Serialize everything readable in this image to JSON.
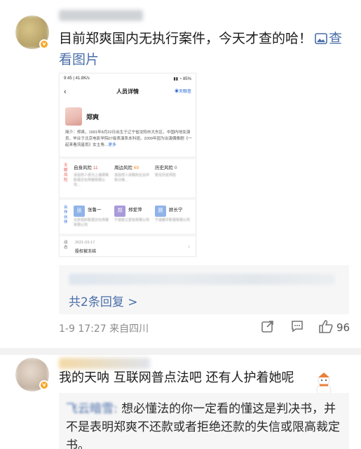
{
  "comment1": {
    "text": "目前郑爽国内无执行案件，今天才查的哈！",
    "link_icon": "image-icon",
    "link_text": "查看图片",
    "screenshot": {
      "status_left": "9:45 | 41.8K/s",
      "status_right": "85",
      "nav_back": "‹",
      "nav_title": "人员详情",
      "nav_brand": "天眼查",
      "person_name": "郑爽",
      "intro": "简介：郑爽，1991年8月22日出生于辽宁省沈阳市大东区，中国内地女演员，毕业于北京电影学院07级表演系本科班。2009年因为出演偶像剧《一起来看流星雨》女主角…",
      "intro_more": "更多",
      "risk_side_label": "天眼风险",
      "risks": [
        {
          "label": "自身风险",
          "value": "11",
          "sub": "该自然人曾为上海郑爽影视文化传媒有限公司…"
        },
        {
          "label": "周边风险",
          "value": "69",
          "sub": "该自然人关联的企业中有10条…"
        },
        {
          "label": "历史风险",
          "value": "0",
          "sub": "暂无历史风险"
        }
      ],
      "partner_side_label": "合作伙伴",
      "partners": [
        {
          "initial": "张",
          "name": "张鲁一",
          "sub": "北京坦好影视文化传媒有限公司",
          "color": "#8fb3e8"
        },
        {
          "initial": "郑",
          "name": "郑爱萍",
          "sub": "宁波奇之爱信有限公司",
          "color": "#a99ad9"
        },
        {
          "initial": "顾",
          "name": "顾长宁",
          "sub": "宁波鑫宇影视有限公司",
          "color": "#8fb3e8"
        }
      ],
      "dynamic_side_label": "动态",
      "dynamic_date": "2021-03-17",
      "dynamic_text": "股权被冻结",
      "dynamic_arrow": "›"
    },
    "reply_count": "共2条回复 >",
    "meta": "1-9 17:27  来自四川",
    "likes": "96"
  },
  "comment2": {
    "text": "我的天呐 互联网普点法吧 还有人护着她呢",
    "reply_prefix": "飞云暗雪:",
    "reply_text": " 想必懂法的你一定看的懂这是判决书，并不是表明郑爽不还款或者拒绝还款的失信或限高裁定书。"
  },
  "icons": {
    "share": "share-icon",
    "comment": "comment-icon",
    "like": "thumbs-up-icon"
  },
  "colors": {
    "link": "#4a6ea9",
    "risk_red": "#e2574c",
    "brand_blue": "#2d6bd6",
    "vip_badge": "#f5a623"
  }
}
